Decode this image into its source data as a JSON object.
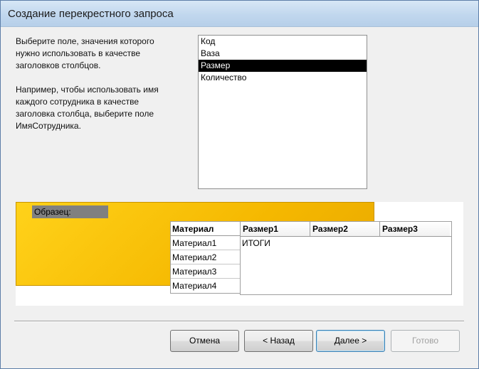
{
  "window": {
    "title": "Создание перекрестного запроса"
  },
  "instructions": {
    "line1": "Выберите поле, значения которого",
    "line2": "нужно использовать в качестве",
    "line3": "заголовков столбцов.",
    "ex1": "Например, чтобы использовать имя",
    "ex2": "каждого сотрудника в качестве",
    "ex3": "заголовка столбца, выберите поле",
    "ex4": "ИмяСотрудника."
  },
  "fields": {
    "items": [
      "Код",
      "Ваза",
      "Размер",
      "Количество"
    ],
    "selected": "Размер"
  },
  "preview": {
    "label": "Образец:",
    "row_header": "Материал",
    "rows": [
      "Материал1",
      "Материал2",
      "Материал3",
      "Материал4"
    ],
    "columns": [
      "Размер1",
      "Размер2",
      "Размер3"
    ],
    "totals": "ИТОГИ"
  },
  "buttons": {
    "cancel": "Отмена",
    "back": "< Назад",
    "next": "Далее >",
    "finish": "Готово"
  },
  "colors": {
    "selection": "#000000",
    "preview_yellow": "#f5b800",
    "sample_label_bg": "#808080"
  }
}
